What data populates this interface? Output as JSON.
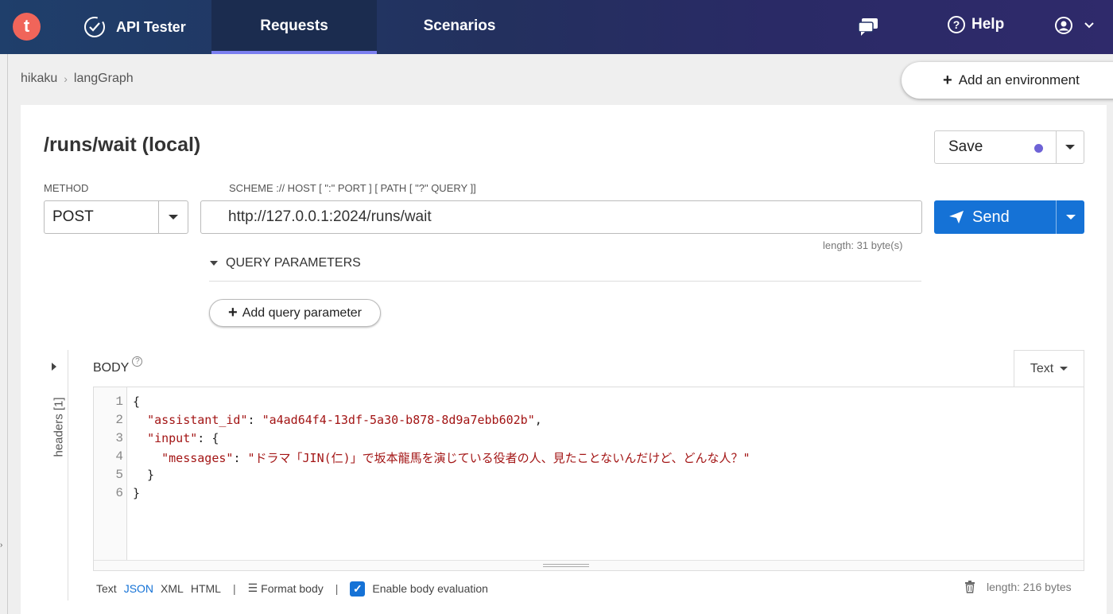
{
  "app": {
    "logo_letter": "t",
    "brand_label": "API Tester"
  },
  "nav": {
    "requests": "Requests",
    "scenarios": "Scenarios",
    "help": "Help"
  },
  "breadcrumb": {
    "project": "hikaku",
    "separator": "›",
    "service": "langGraph"
  },
  "environment": {
    "add_label": "Add an environment"
  },
  "request": {
    "title": "/runs/wait (local)",
    "save_label": "Save",
    "method_label": "METHOD",
    "method_value": "POST",
    "url_label": "SCHEME :// HOST [ \":\" PORT ] [ PATH [ \"?\" QUERY ]]",
    "url_value": "http://127.0.0.1:2024/runs/wait",
    "url_length": "length: 31 byte(s)",
    "send_label": "Send",
    "query_params_label": "QUERY PARAMETERS",
    "add_query_param_label": "Add query parameter"
  },
  "body": {
    "label": "BODY",
    "headers_tab": "headers [1]",
    "type_select": "Text",
    "lines": [
      {
        "n": "1",
        "text": "{"
      },
      {
        "n": "2",
        "indent": "  ",
        "key": "\"assistant_id\"",
        "sep": ": ",
        "value": "\"a4ad64f4-13df-5a30-b878-8d9a7ebb602b\"",
        "tail": ","
      },
      {
        "n": "3",
        "indent": "  ",
        "key": "\"input\"",
        "sep": ": ",
        "tail": "{"
      },
      {
        "n": "4",
        "indent": "    ",
        "key": "\"messages\"",
        "sep": ": ",
        "value": "\"ドラマ「JIN(仁)」で坂本龍馬を演じている役者の人、見たことないんだけど、どんな人？\""
      },
      {
        "n": "5",
        "text": "  }"
      },
      {
        "n": "6",
        "text": "}"
      }
    ],
    "formats": [
      "Text",
      "JSON",
      "XML",
      "HTML"
    ],
    "active_format": "JSON",
    "format_body_label": "Format body",
    "enable_eval_label": "Enable body evaluation",
    "enable_eval_checked": true,
    "length_label": "length: 216 bytes"
  },
  "colors": {
    "accent": "#1572d6",
    "save_dot": "#6e63d6",
    "logo": "#f0655a",
    "json_key": "#a31515"
  },
  "icons": [
    "api-tester-icon",
    "chat-icon",
    "help-icon",
    "user-icon",
    "chevron-down-icon",
    "send-icon",
    "trash-icon",
    "format-icon"
  ]
}
